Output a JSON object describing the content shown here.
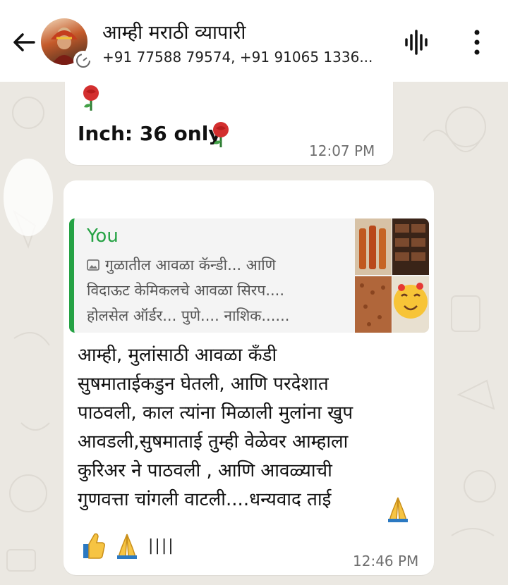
{
  "header": {
    "title": "आम्ही मराठी व्यापारी",
    "subtitle": "+91 77588 79574, +91 91065 1336..."
  },
  "messages": [
    {
      "text": "Inch: 36 only",
      "time": "12:07 PM"
    },
    {
      "quote": {
        "author": "You",
        "lines": [
          "गुळातील आवळा कॅन्डी... आणि",
          "विदाऊट केमिकलचे आवळा सिरप....",
          "होलसेल ऑर्डर... पुणे.... नाशिक......"
        ]
      },
      "lines": [
        "आम्ही, मुलांसाठी आवळा कँडी",
        "सुषमाताईकडुन घेतली, आणि परदेशात",
        "पाठवली, काल त्यांना मिळाली मुलांना खुप",
        "आवडली,सुषमाताई तुम्ही वेळेवर आम्हाला",
        "कुरिअर ने पाठवली , आणि आवळ्याची",
        "गुणवत्ता चांगली वाटली....धन्यवाद ताई"
      ],
      "tail": "||||",
      "time": "12:46 PM"
    }
  ],
  "colors": {
    "accent": "#25a244",
    "background": "#ebe8e2",
    "bubble": "#ffffff"
  },
  "icons": [
    "back-arrow-icon",
    "voice-waveform-icon",
    "more-vert-icon",
    "image-icon",
    "rose-emoji",
    "thumbs-up-emoji",
    "folded-hands-emoji"
  ]
}
